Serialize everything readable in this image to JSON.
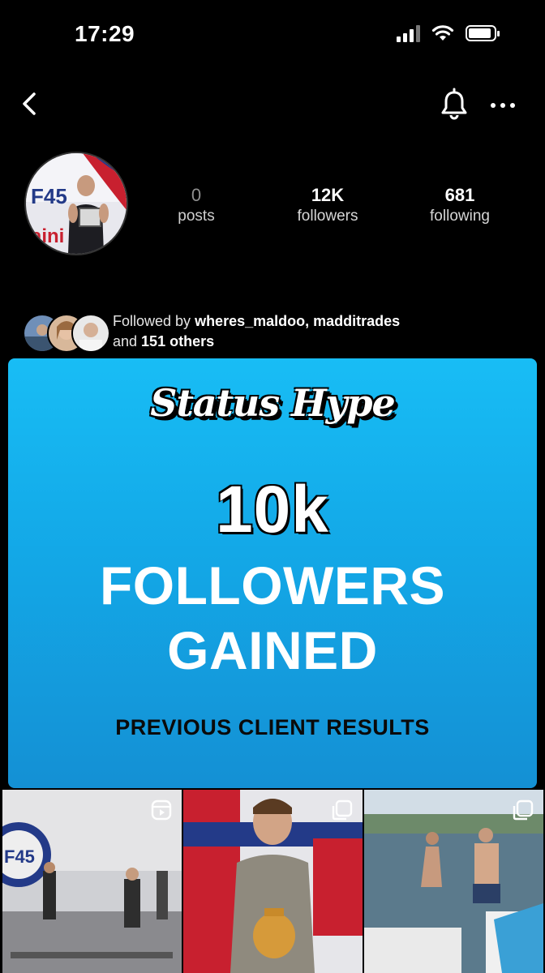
{
  "status_bar": {
    "time": "17:29"
  },
  "profile": {
    "stats": [
      {
        "value": "0",
        "label": "posts"
      },
      {
        "value": "12K",
        "label": "followers"
      },
      {
        "value": "681",
        "label": "following"
      }
    ],
    "followed_by": {
      "prefix": "Followed by ",
      "names": "wheres_maldoo, madditrades",
      "and_text": "and ",
      "others": "151 others"
    }
  },
  "promo": {
    "brand": "Status Hype",
    "number": "10k",
    "line1": "FOLLOWERS",
    "line2": "GAINED",
    "subline": "PREVIOUS CLIENT RESULTS"
  },
  "icons": [
    "back-icon",
    "bell-icon",
    "more-icon",
    "reel-icon",
    "carousel-icon"
  ],
  "colors": {
    "accent": "#15aee9",
    "background": "#000000"
  }
}
